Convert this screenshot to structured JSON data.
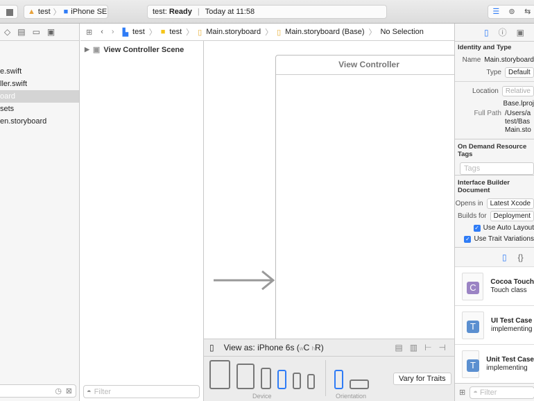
{
  "toolbar": {
    "scheme": "test",
    "device": "iPhone SE",
    "status_project": "test:",
    "status_state": "Ready",
    "status_time": "Today at 11:58"
  },
  "navigator": {
    "items": [
      {
        "label": "e.swift"
      },
      {
        "label": "ller.swift"
      },
      {
        "label": "oard",
        "selected": true
      },
      {
        "label": "sets"
      },
      {
        "label": "en.storyboard"
      }
    ]
  },
  "jumpbar": {
    "items": [
      "test",
      "test",
      "Main.storyboard",
      "Main.storyboard (Base)",
      "No Selection"
    ]
  },
  "outline": {
    "scene": "View Controller Scene",
    "filter_placeholder": "Filter"
  },
  "canvas": {
    "scene_title": "View Controller"
  },
  "viewas": {
    "label": "View as: iPhone 6s (",
    "w": "w",
    "c": "C",
    "h": "h",
    "r": "R)"
  },
  "devices": {
    "device_label": "Device",
    "orientation_label": "Orientation",
    "vary_button": "Vary for Traits"
  },
  "inspector": {
    "identity_title": "Identity and Type",
    "name_label": "Name",
    "name_value": "Main.storyboard",
    "type_label": "Type",
    "type_value": "Default",
    "location_label": "Location",
    "location_value": "Relative",
    "location_file": "Base.lproj",
    "fullpath_label": "Full Path",
    "fullpath_lines": [
      "/Users/a",
      "test/Bas",
      "Main.sto"
    ],
    "odr_title": "On Demand Resource Tags",
    "tags_placeholder": "Tags",
    "ib_title": "Interface Builder Document",
    "opens_label": "Opens in",
    "opens_value": "Latest Xcode",
    "builds_label": "Builds for",
    "builds_value": "Deployment",
    "check1": "Use Auto Layout",
    "check2": "Use Trait Variations"
  },
  "library": {
    "items": [
      {
        "title": "Cocoa Touch",
        "subtitle": "Touch class",
        "letter": "C",
        "color": "#9b84c4"
      },
      {
        "title": "UI Test Case",
        "subtitle": "implementing",
        "letter": "T",
        "color": "#5b8fd0"
      },
      {
        "title": "Unit Test Case",
        "subtitle": "implementing",
        "letter": "T",
        "color": "#5b8fd0"
      }
    ],
    "filter_placeholder": "Filter"
  },
  "colors": {
    "accent": "#2f7cf6"
  }
}
